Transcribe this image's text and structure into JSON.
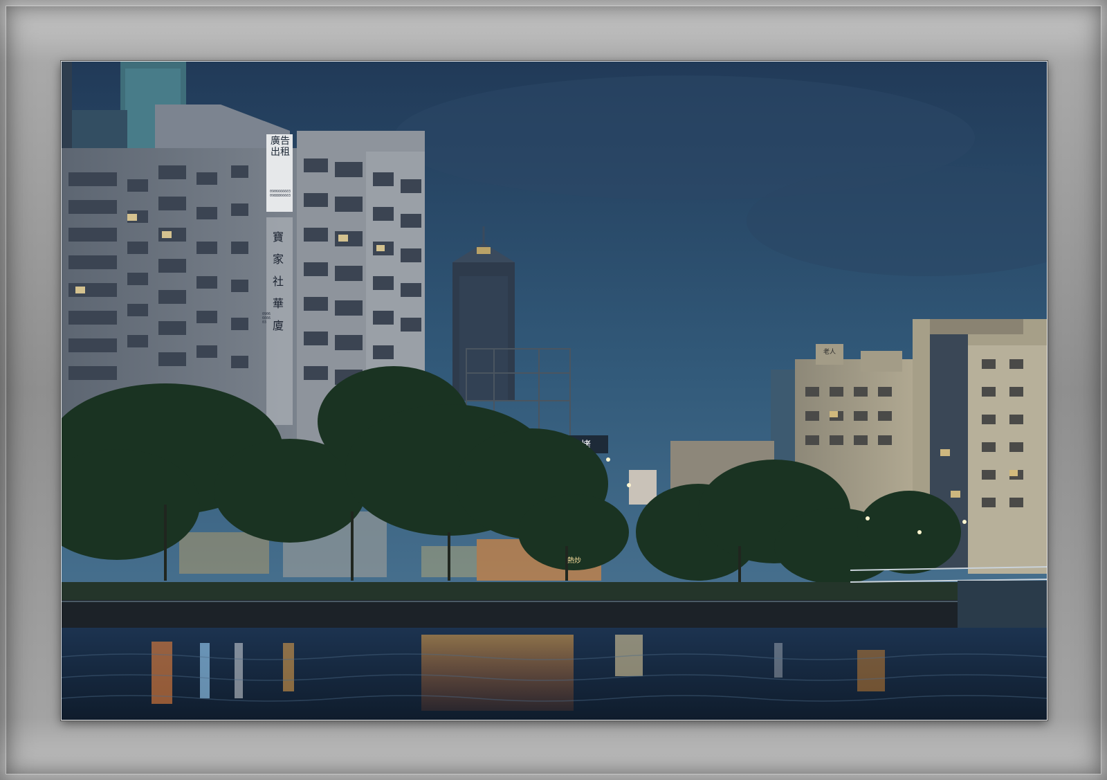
{
  "photo": {
    "signs": {
      "rental_ad_top": "廣告出租",
      "phone_top": "0906666603",
      "phone_top_2": "0988866603",
      "building_name_1": "寶",
      "building_name_2": "家",
      "building_name_3": "社",
      "building_name_4": "華",
      "building_name_5": "廈",
      "phone_side": "0906666603",
      "roof_sign": "老人",
      "neon_sign": "海鮮燒烤",
      "restaurant_sign": "熱炒"
    },
    "colors": {
      "sky_top": "#2a4766",
      "sky_bottom": "#3f6786",
      "water": "#1a2e44",
      "neon_orange": "#ff9a2e",
      "neon_green": "#3ddc6a",
      "neon_blue": "#7fd0ff",
      "frame_gray": "#9a9a9a"
    }
  }
}
